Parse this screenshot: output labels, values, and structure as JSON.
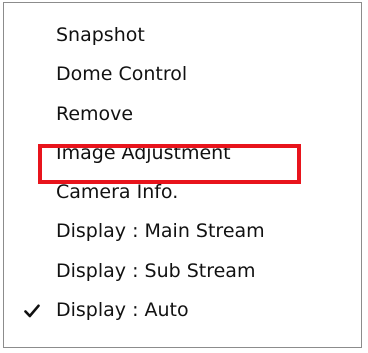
{
  "context_menu": {
    "items": [
      {
        "label": "Snapshot",
        "checked": false
      },
      {
        "label": "Dome Control",
        "checked": false
      },
      {
        "label": "Remove",
        "checked": false
      },
      {
        "label": "Image Adjustment",
        "checked": false,
        "highlighted": true
      },
      {
        "label": "Camera Info.",
        "checked": false
      },
      {
        "label": "Display : Main Stream",
        "checked": false
      },
      {
        "label": "Display : Sub Stream",
        "checked": false
      },
      {
        "label": "Display : Auto",
        "checked": true
      }
    ],
    "highlight_color": "#e8141c",
    "check_icon": "checkmark-icon"
  }
}
